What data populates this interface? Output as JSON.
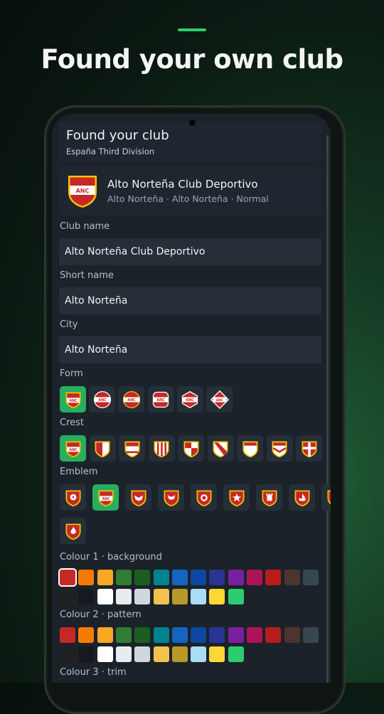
{
  "headline": "Found your own club",
  "header": {
    "title": "Found your club",
    "subtitle": "España Third Division"
  },
  "club": {
    "name": "Alto Norteña Club Deportivo",
    "meta": "Alto Norteña · Alto Norteña · Normal",
    "crest_text": "ANC",
    "colors": {
      "primary": "#c62828",
      "secondary": "#ffffff",
      "trim": "#f2c300"
    }
  },
  "fields": {
    "club_name": {
      "label": "Club name",
      "value": "Alto Norteña Club Deportivo"
    },
    "short_name": {
      "label": "Short name",
      "value": "Alto Norteña"
    },
    "city": {
      "label": "City",
      "value": "Alto Norteña"
    }
  },
  "sections": {
    "form": "Form",
    "crest": "Crest",
    "emblem": "Emblem",
    "colour1": "Colour 1 · background",
    "colour2": "Colour 2 · pattern",
    "colour3": "Colour 3 · trim"
  },
  "form_options": [
    "shield-classic",
    "round-band",
    "round-band-alt",
    "square-band",
    "hexagon-band",
    "diamond-band"
  ],
  "form_selected": 0,
  "crest_options": [
    "band-center",
    "split-vertical",
    "band-top",
    "stripes-vertical",
    "split-quarter",
    "diagonal-band",
    "band-high",
    "chevron",
    "cross"
  ],
  "crest_selected": 0,
  "emblem_options": [
    "ball-icon",
    "crest-badge",
    "eagle-icon",
    "bull-icon",
    "lion-icon",
    "star-icon",
    "tower-icon",
    "ship-icon",
    "sun-icon",
    "flame-icon"
  ],
  "emblem_selected": 1,
  "palette": [
    "#c62828",
    "#f57c00",
    "#f9a825",
    "#2e7d32",
    "#1b5e20",
    "#00838f",
    "#1565c0",
    "#0d47a1",
    "#283593",
    "#7b1fa2",
    "#ad1457",
    "#b71c1c",
    "#4e342e",
    "#37474f",
    "#212121",
    "#161a1e",
    "#ffffff",
    "#e8ecee",
    "#cfd8dc",
    "#f2c14e",
    "#b89a2a",
    "#a9dcf5",
    "#fdd835",
    "#2ecc71"
  ],
  "colour1_selected": 0,
  "colour2_selected": null
}
